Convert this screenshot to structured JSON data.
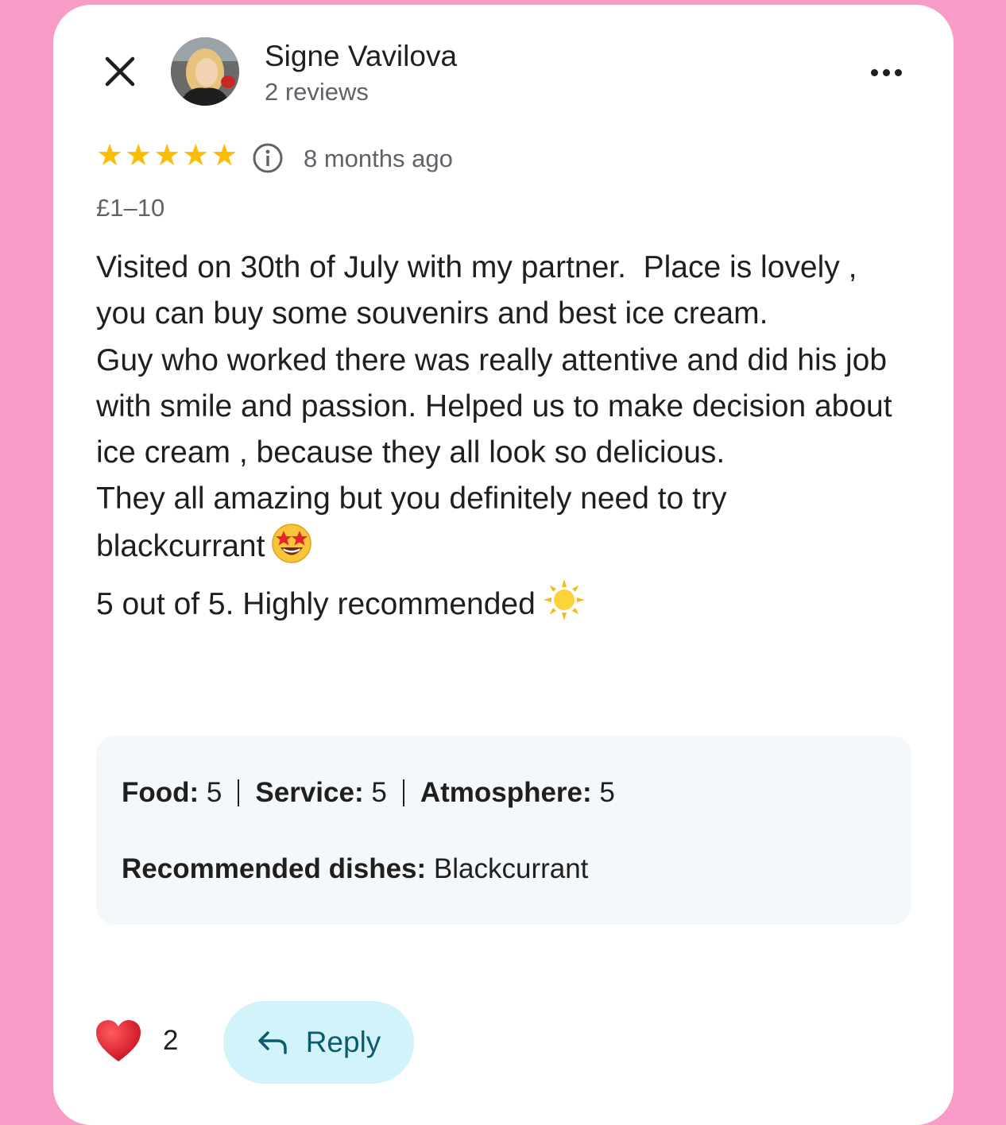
{
  "reviewer": {
    "name": "Signe Vavilova",
    "review_count": "2 reviews"
  },
  "rating": {
    "stars": 5,
    "max_stars": 5,
    "time_ago": "8 months ago"
  },
  "price_range": "£1–10",
  "review": {
    "paragraphs": [
      "Visited on 30th of July with my partner.  Place is lovely , you can buy some souvenirs and best ice cream.",
      "Guy who worked there was really attentive and did his job with smile and passion. Helped us to make decision about ice cream , because they all look so delicious.",
      "They all amazing but you definitely need to try blackcurrant",
      "5 out of 5. Highly recommended"
    ]
  },
  "details": {
    "food_label": "Food:",
    "food_value": "5",
    "service_label": "Service:",
    "service_value": "5",
    "atmosphere_label": "Atmosphere:",
    "atmosphere_value": "5",
    "dishes_label": "Recommended dishes:",
    "dishes_value": "Blackcurrant"
  },
  "actions": {
    "like_count": "2",
    "reply_label": "Reply"
  },
  "icons": {
    "close": "close-icon",
    "more": "more-icon",
    "info": "info-icon",
    "heart": "heart-icon",
    "reply": "reply-arrow-icon",
    "star_struck": "star-struck-emoji-icon",
    "sun": "sun-emoji-icon"
  },
  "colors": {
    "background": "#f79cc6",
    "star": "#fbbc04",
    "reply_bg": "#d3f3fb",
    "reply_text": "#0b5b6e",
    "heart": "#e0182d"
  }
}
